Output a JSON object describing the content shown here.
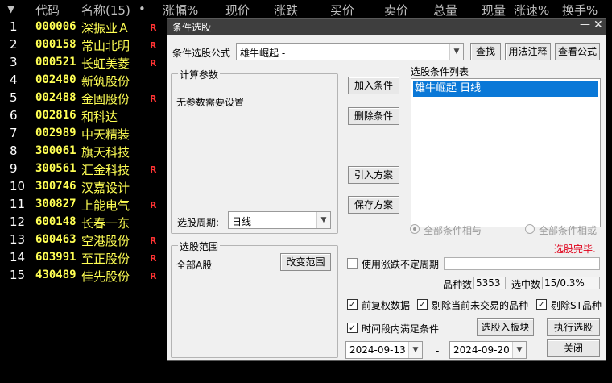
{
  "table": {
    "headers": {
      "sort": "▼",
      "code": "代码",
      "name": "名称(15)",
      "dot": "•",
      "change_pct": "涨幅%",
      "price": "现价",
      "change": "涨跌",
      "bid": "买价",
      "ask": "卖价",
      "volume": "总量",
      "cur_volume": "现量",
      "speed": "涨速%",
      "turnover": "换手%"
    },
    "rows": [
      {
        "idx": "1",
        "code": "000006",
        "name": "深振业Ａ",
        "flag": "R"
      },
      {
        "idx": "2",
        "code": "000158",
        "name": "常山北明",
        "flag": "R"
      },
      {
        "idx": "3",
        "code": "000521",
        "name": "长虹美菱",
        "flag": "R"
      },
      {
        "idx": "4",
        "code": "002480",
        "name": "新筑股份",
        "flag": ""
      },
      {
        "idx": "5",
        "code": "002488",
        "name": "金固股份",
        "flag": "R"
      },
      {
        "idx": "6",
        "code": "002816",
        "name": "和科达",
        "flag": ""
      },
      {
        "idx": "7",
        "code": "002989",
        "name": "中天精装",
        "flag": ""
      },
      {
        "idx": "8",
        "code": "300061",
        "name": "旗天科技",
        "flag": ""
      },
      {
        "idx": "9",
        "code": "300561",
        "name": "汇金科技",
        "flag": "R"
      },
      {
        "idx": "10",
        "code": "300746",
        "name": "汉嘉设计",
        "flag": ""
      },
      {
        "idx": "11",
        "code": "300827",
        "name": "上能电气",
        "flag": "R"
      },
      {
        "idx": "12",
        "code": "600148",
        "name": "长春一东",
        "flag": ""
      },
      {
        "idx": "13",
        "code": "600463",
        "name": "空港股份",
        "flag": "R"
      },
      {
        "idx": "14",
        "code": "603991",
        "name": "至正股份",
        "flag": "R"
      },
      {
        "idx": "15",
        "code": "430489",
        "name": "佳先股份",
        "flag": "R"
      }
    ]
  },
  "dialog": {
    "title": "条件选股",
    "minimize_glyph": "—",
    "close_glyph": "✕",
    "formula_label": "条件选股公式",
    "formula_value": "雄牛崛起    -",
    "find_button": "查找",
    "usage_button": "用法注释",
    "view_formula_button": "查看公式",
    "params_group_title": "计算参数",
    "params_text": "无参数需要设置",
    "period_label": "选股周期:",
    "period_value": "日线",
    "add_condition_button": "加入条件",
    "delete_condition_button": "删除条件",
    "import_plan_button": "引入方案",
    "save_plan_button": "保存方案",
    "condition_list_title": "选股条件列表",
    "condition_items": [
      "雄牛崛起  日线"
    ],
    "radio_and_label": "全部条件相与",
    "radio_or_label": "全部条件相或",
    "status_text": "选股完毕.",
    "range_group_title": "选股范围",
    "range_value": "全部A股",
    "change_range_button": "改变范围",
    "use_change_label": "使用涨跌不定周期",
    "use_change_value": "",
    "count_label": "品种数",
    "count_value": "5353",
    "selected_label": "选中数",
    "selected_value": "15/0.3%",
    "fq_label": "前复权数据",
    "exclude_untraded_label": "剔除当前未交易的品种",
    "exclude_st_label": "剔除ST品种",
    "period_satisfy_label": "时间段内满足条件",
    "to_block_button": "选股入板块",
    "execute_button": "执行选股",
    "date_start": "2024-09-13",
    "date_sep": "-",
    "date_end": "2024-09-20",
    "close_button": "关闭",
    "check_glyph": "✓",
    "combo_arrow": "▼"
  },
  "colors": {
    "code_text": "#ffff54",
    "flag_text": "#ff3333",
    "status_text": "#e0001a",
    "selection": "#0a78d7"
  }
}
